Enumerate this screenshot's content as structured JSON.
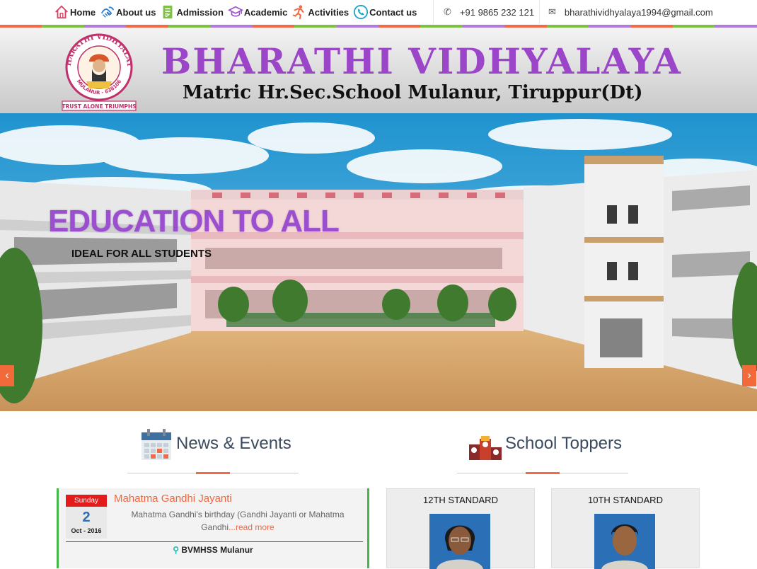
{
  "nav": {
    "items": [
      {
        "label": "Home",
        "icon": "home-icon"
      },
      {
        "label": "About us",
        "icon": "handshake-icon"
      },
      {
        "label": "Admission",
        "icon": "form-icon"
      },
      {
        "label": "Academic",
        "icon": "graduation-cap-icon"
      },
      {
        "label": "Activities",
        "icon": "running-person-icon"
      },
      {
        "label": "Contact us",
        "icon": "phone-circle-icon"
      }
    ]
  },
  "contact": {
    "phone": "+91 9865 232 121",
    "email": "bharathividhyalaya1994@gmail.com"
  },
  "header": {
    "title": "BHARATHI VIDHYALAYA",
    "subtitle": "Matric Hr.Sec.School Mulanur, Tiruppur(Dt)",
    "logo": {
      "arc_top": "BHARATHI VIDHYALAYA",
      "arc_bottom": "MULANUR - 638106",
      "motto": "TRUST ALONE TRIUMPHS"
    }
  },
  "hero": {
    "title": "EDUCATION TO ALL",
    "subtitle": "IDEAL FOR ALL STUDENTS",
    "prev_icon": "chevron-left-icon",
    "next_icon": "chevron-right-icon"
  },
  "news": {
    "heading": "News & Events",
    "icon": "calendar-icon",
    "items": [
      {
        "day_name": "Sunday",
        "day": "2",
        "month_year": "Oct - 2016",
        "title": "Mahatma Gandhi Jayanti",
        "description": "Mahatma Gandhi's birthday (Gandhi Jayanti or Mahatma Gandhi",
        "more": "...read more",
        "location": "BVMHSS Mulanur"
      }
    ]
  },
  "toppers": {
    "heading": "School Toppers",
    "icon": "podium-icon",
    "cards": [
      {
        "label": "12TH STANDARD"
      },
      {
        "label": "10TH STANDARD"
      }
    ]
  },
  "colors": {
    "accent": "#f0673f",
    "title_purple": "#9b45c8",
    "green": "#45b84a",
    "date_red": "#e31b1b"
  }
}
